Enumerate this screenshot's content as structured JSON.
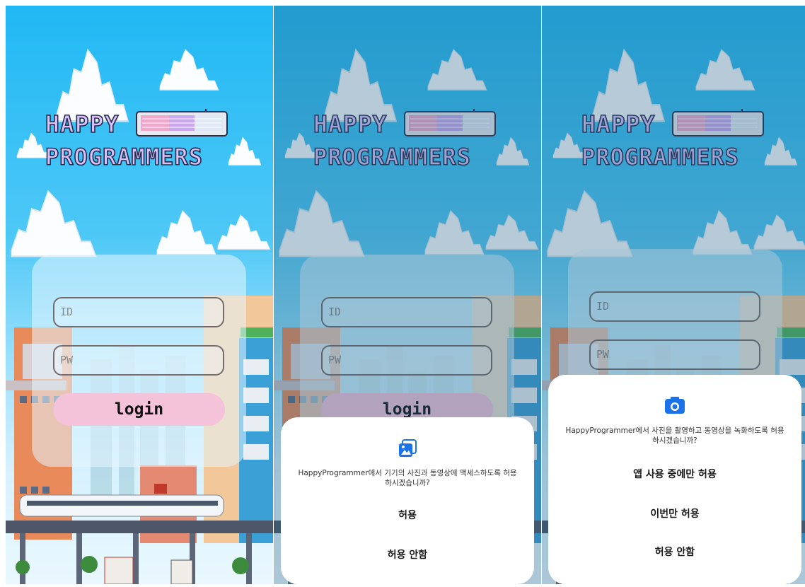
{
  "logo": {
    "line1": "HAPPY",
    "line2": "PROGRAMMERS"
  },
  "login_form": {
    "id_placeholder": "ID",
    "pw_placeholder": "PW",
    "login_label": "login"
  },
  "photo_permission": {
    "icon": "image-icon",
    "message": "HappyProgrammer에서 기기의 사진과 동영상에 액세스하도록 허용하시겠습니까?",
    "allow": "허용",
    "deny": "허용 안함"
  },
  "camera_permission": {
    "icon": "camera-icon",
    "message": "HappyProgrammer에서 사진을 촬영하고 동영상을 녹화하도록 허용하시겠습니까?",
    "allow_while_using": "앱 사용 중에만 허용",
    "allow_once": "이번만 허용",
    "deny": "허용 안함"
  },
  "colors": {
    "sky": "#20b8f4",
    "login_button": "#f4c2d9",
    "permission_icon": "#1a73e8",
    "field_border": "#776b6b"
  }
}
